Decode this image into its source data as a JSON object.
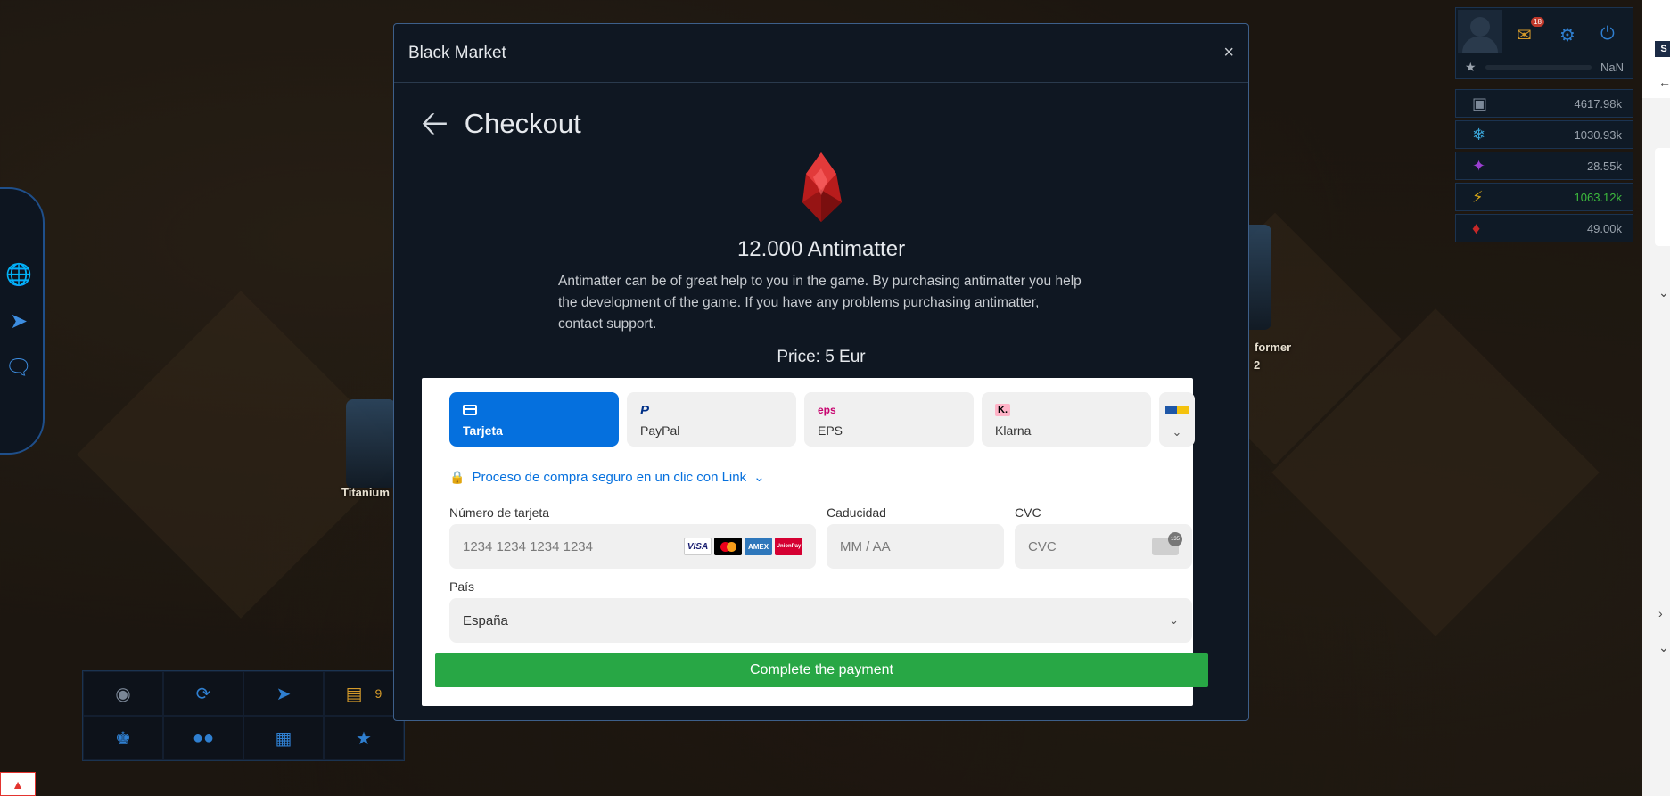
{
  "modal": {
    "title": "Black Market",
    "close_label": "×",
    "checkout_title": "Checkout",
    "product": {
      "name": "12.000 Antimatter",
      "description": "Antimatter can be of great help to you in the game. By purchasing antimatter you help the development of the game. If you have any problems purchasing antimatter, contact support.",
      "price": "Price: 5 Eur"
    }
  },
  "payment": {
    "methods": [
      {
        "label": "Tarjeta",
        "icon": "card-icon",
        "active": true
      },
      {
        "label": "PayPal",
        "icon": "paypal-icon",
        "active": false
      },
      {
        "label": "EPS",
        "icon": "eps-icon",
        "active": false
      },
      {
        "label": "Klarna",
        "icon": "klarna-icon",
        "active": false
      }
    ],
    "link_text": "Proceso de compra seguro en un clic con Link",
    "card_number": {
      "label": "Número de tarjeta",
      "placeholder": "1234 1234 1234 1234"
    },
    "expiry": {
      "label": "Caducidad",
      "placeholder": "MM / AA"
    },
    "cvc": {
      "label": "CVC",
      "placeholder": "CVC"
    },
    "country": {
      "label": "País",
      "value": "España"
    },
    "submit_label": "Complete the payment",
    "accent_color": "#0570de",
    "submit_color": "#28a745"
  },
  "user_panel": {
    "mail_count": "18",
    "level_value": "NaN"
  },
  "resources": [
    {
      "icon": "metal-icon",
      "value": "4617.98k",
      "color": "#9aa3ad"
    },
    {
      "icon": "crystal-icon",
      "value": "1030.93k",
      "color": "#9aa3ad"
    },
    {
      "icon": "deuterium-icon",
      "value": "28.55k",
      "color": "#9aa3ad"
    },
    {
      "icon": "energy-icon",
      "value": "1063.12k",
      "color": "#3dbb3d"
    },
    {
      "icon": "antimatter-icon",
      "value": "49.00k",
      "color": "#9aa3ad"
    }
  ],
  "background": {
    "building_labels": [
      "Titanium",
      "former",
      "2"
    ]
  },
  "bottom_bar": {
    "inbox_count": "9"
  },
  "browser": {
    "s_badge": "S"
  }
}
